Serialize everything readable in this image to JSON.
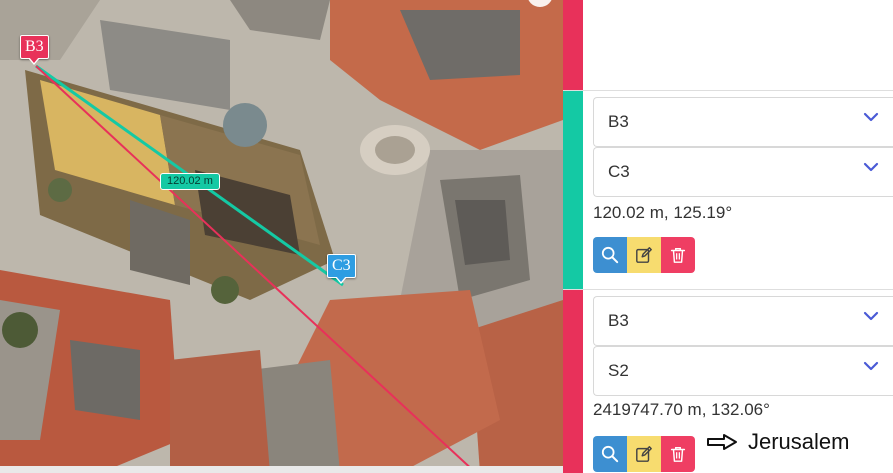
{
  "map": {
    "marker_start": "B3",
    "marker_end": "C3",
    "distance_label": "120.02 m"
  },
  "colors": {
    "red": "#e8315a",
    "teal": "#14c9a4",
    "blue": "#2e9de2",
    "search_btn": "#3d8fd1",
    "edit_btn": "#f7dc6f",
    "delete_btn": "#ef3e63"
  },
  "measurements": [
    {
      "from": "B3",
      "to": "C3",
      "result": "120.02 m, 125.19°",
      "color": "teal"
    },
    {
      "from": "B3",
      "to": "S2",
      "result": "2419747.70 m, 132.06°",
      "color": "red"
    }
  ],
  "icons": {
    "search": "search-icon",
    "edit": "edit-icon",
    "delete": "trash-icon",
    "dropdown": "chevron-down-icon",
    "annotation": "arrow-right-icon"
  },
  "annotation": {
    "text": "Jerusalem"
  }
}
